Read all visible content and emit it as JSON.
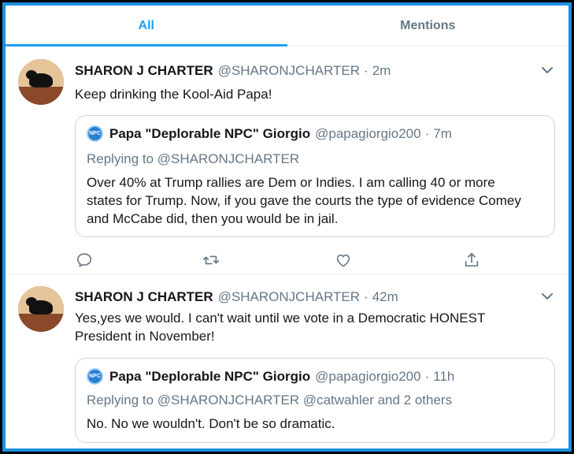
{
  "tabs": [
    {
      "label": "All",
      "active": true
    },
    {
      "label": "Mentions",
      "active": false
    }
  ],
  "colors": {
    "accent": "#1da1f2",
    "frame": "#1a8fe0",
    "muted": "#657786",
    "border": "#e6ecf0"
  },
  "tweets": [
    {
      "name": "SHARON J CHARTER",
      "handle": "@SHARONJCHARTER",
      "separator": "·",
      "time": "2m",
      "text": "Keep drinking the Kool-Aid Papa!",
      "quote": {
        "badge": "NPC",
        "name": "Papa \"Deplorable NPC\" Giorgio",
        "handle": "@papagiorgio200",
        "separator": "·",
        "time": "7m",
        "reply_to": "Replying to @SHARONJCHARTER",
        "text_lines": [
          "Over 40% at Trump rallies are Dem or Indies. I am calling 40 or more",
          "states for Trump. Now, if you gave the courts the type of evidence Comey",
          "and McCabe did, then you would be in jail."
        ]
      },
      "actions": [
        "reply-icon",
        "retweet-icon",
        "like-icon",
        "share-icon"
      ]
    },
    {
      "name": "SHARON J CHARTER",
      "handle": "@SHARONJCHARTER",
      "separator": "·",
      "time": "42m",
      "text_lines": [
        "Yes,yes we would. I can't wait until we vote in a Democratic HONEST",
        "President in November!"
      ],
      "quote": {
        "badge": "NPC",
        "name": "Papa \"Deplorable NPC\" Giorgio",
        "handle": "@papagiorgio200",
        "separator": "·",
        "time": "11h",
        "reply_to": "Replying to @SHARONJCHARTER @catwahler and 2 others",
        "text_lines": [
          "No. No we wouldn't. Don't be so dramatic."
        ]
      }
    }
  ]
}
